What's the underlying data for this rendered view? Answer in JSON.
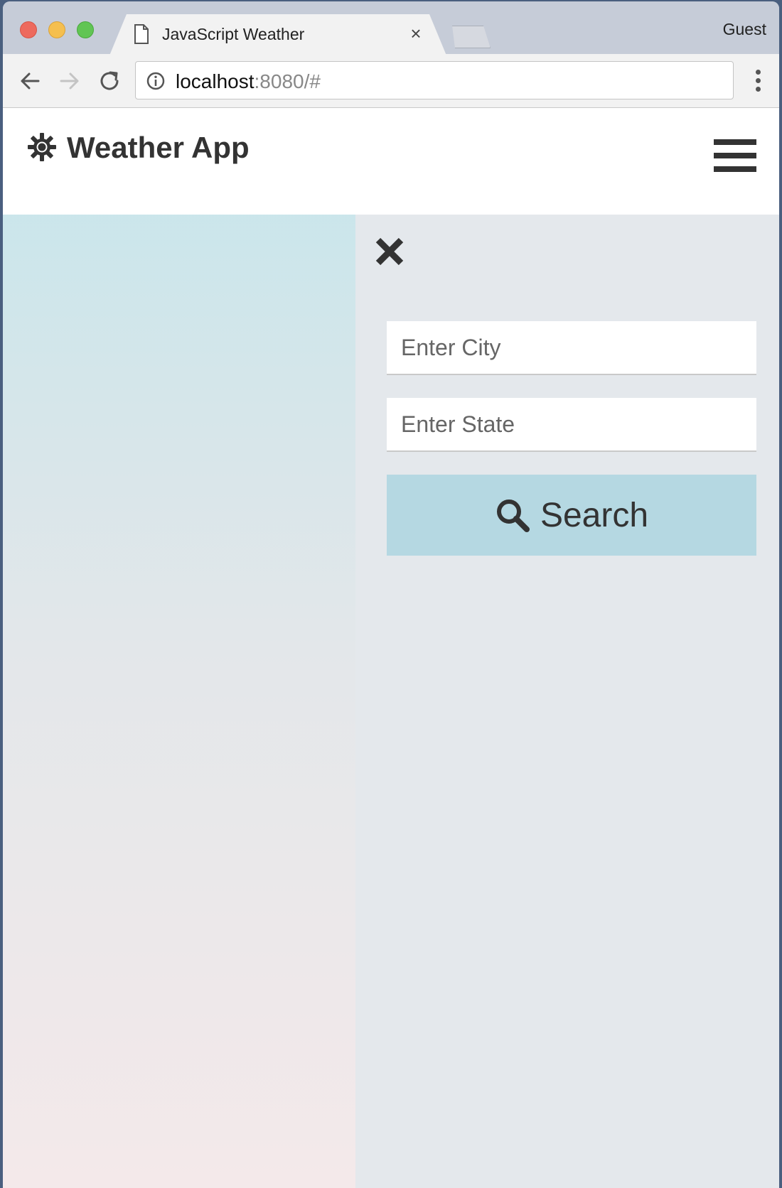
{
  "browser": {
    "tab_title": "JavaScript Weather",
    "tab_close": "×",
    "profile_label": "Guest",
    "url_host": "localhost",
    "url_rest": ":8080/#"
  },
  "app": {
    "brand_icon": "sun-icon",
    "title": "Weather App",
    "menu_icon": "hamburger-menu-icon"
  },
  "search_panel": {
    "close_icon": "close-icon",
    "city_placeholder": "Enter City",
    "city_value": "",
    "state_placeholder": "Enter State",
    "state_value": "",
    "search_label": "Search",
    "search_icon": "magnifier-icon"
  },
  "colors": {
    "accent": "#b5d8e2",
    "text": "#333333",
    "gradient_top": "#c5e5eb",
    "gradient_bottom": "#f4e9ea"
  }
}
